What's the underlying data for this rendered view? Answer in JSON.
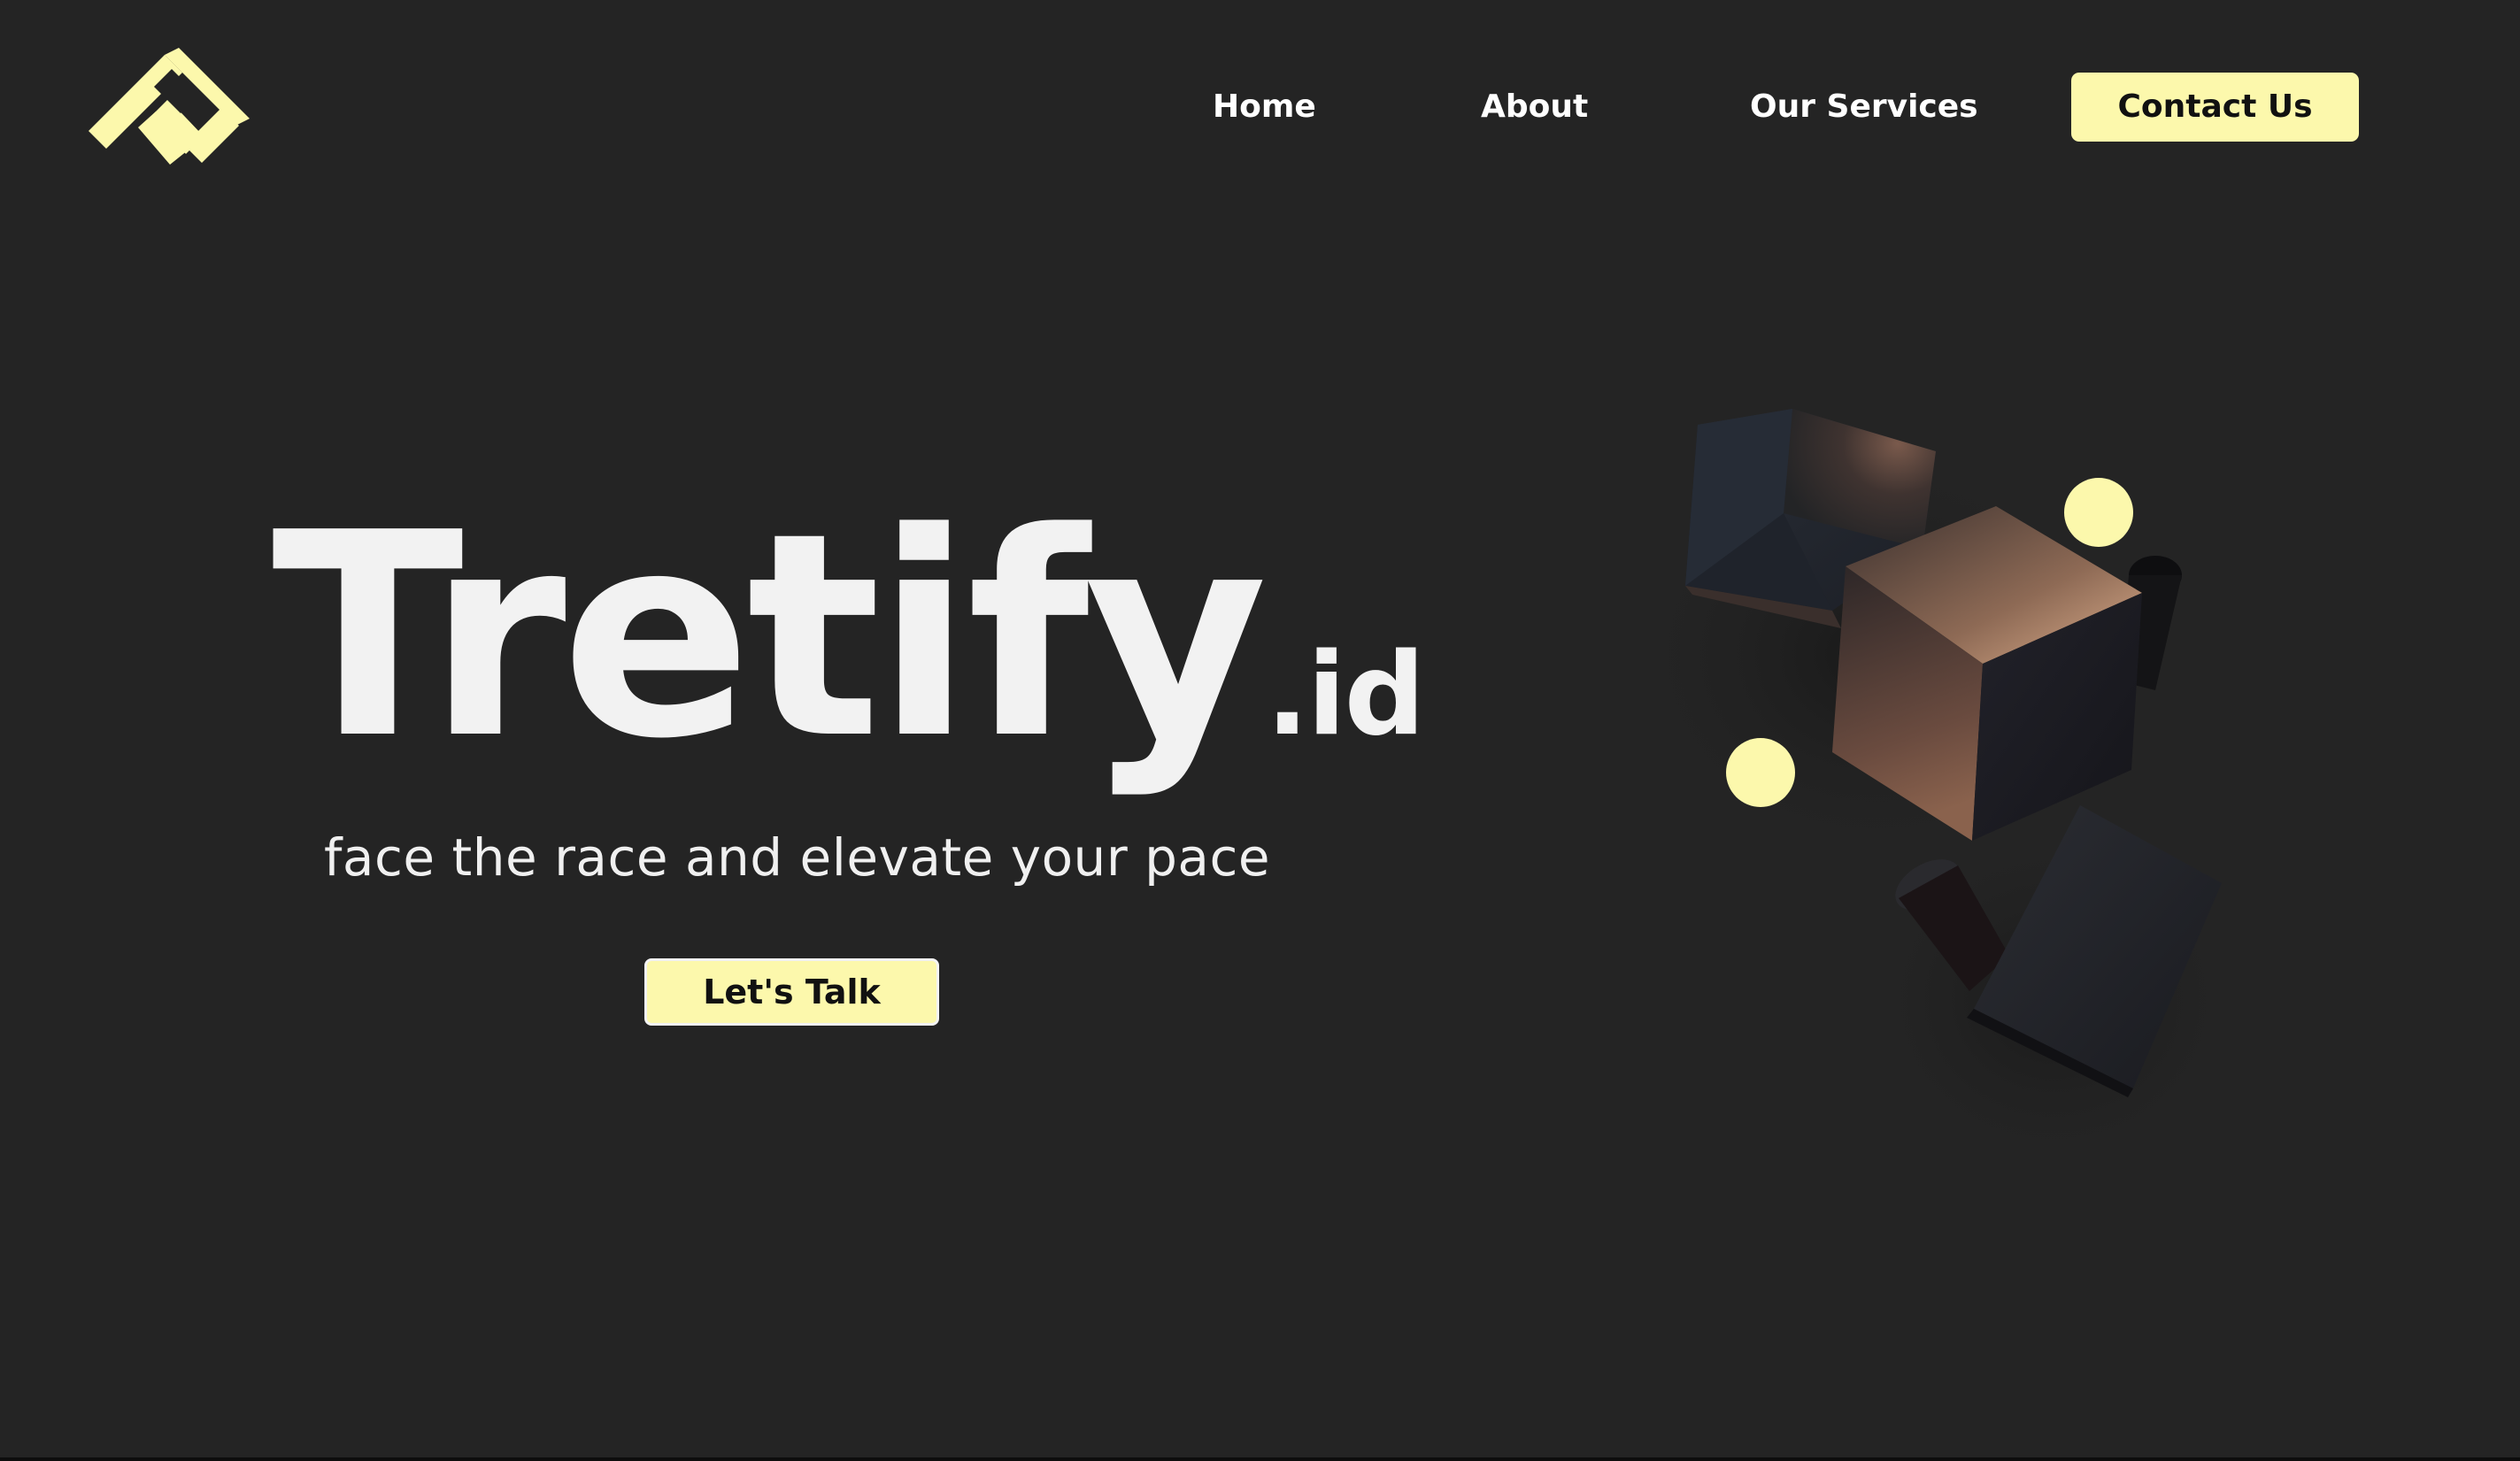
{
  "nav": {
    "home": "Home",
    "about": "About",
    "services": "Our Services",
    "contact": "Contact Us"
  },
  "hero": {
    "brand_name": "Tretify",
    "brand_tld": ".id",
    "tagline": "face the race and elevate your pace",
    "cta": "Let's Talk"
  },
  "icons": {
    "logo": "diamond-logo-icon"
  },
  "colors": {
    "background": "#242424",
    "accent": "#fcf8ac",
    "text": "#ffffff"
  }
}
